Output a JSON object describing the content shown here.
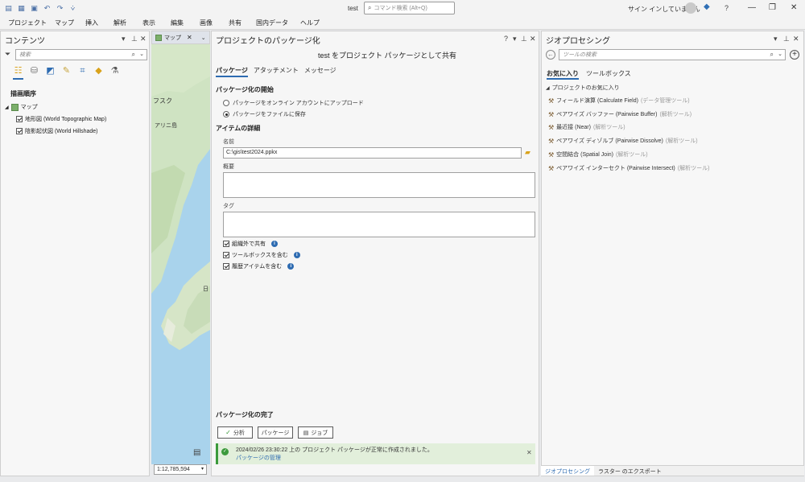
{
  "window": {
    "doc_title": "test",
    "command_search_placeholder": "コマンド検索 (Alt+Q)",
    "signin_text": "サイン インしていません",
    "help": "?"
  },
  "menu": [
    "プロジェクト",
    "マップ",
    "挿入",
    "解析",
    "表示",
    "編集",
    "画像",
    "共有",
    "国内データ",
    "ヘルプ"
  ],
  "contents": {
    "title": "コンテンツ",
    "search_placeholder": "検索",
    "drawing_order_label": "描画順序",
    "map_node": "マップ",
    "layers": [
      "地形図 (World Topographic Map)",
      "陰影起伏図 (World Hillshade)"
    ]
  },
  "map_view": {
    "tab_label": "マップ",
    "labels": [
      "フスク",
      "アリニ島",
      "日"
    ],
    "scale": "1:12,785,594"
  },
  "package": {
    "pane_title": "プロジェクトのパッケージ化",
    "subtitle": "test をプロジェクト パッケージとして共有",
    "tabs": [
      "パッケージ",
      "アタッチメント",
      "メッセージ"
    ],
    "start_section": "パッケージ化の開始",
    "upload_option": "パッケージをオンライン アカウントにアップロード",
    "save_option": "パッケージをファイルに保存",
    "details_section": "アイテムの詳細",
    "name_label": "名前",
    "name_value": "C:\\gis\\test2024.ppkx",
    "summary_label": "概要",
    "tags_label": "タグ",
    "share_outside": "組織外で共有",
    "include_toolboxes": "ツールボックスを含む",
    "include_history": "履歴アイテムを含む",
    "finish_section": "パッケージ化の完了",
    "analyze_button": "分析",
    "package_button": "パッケージ",
    "jobs_button": "ジョブ",
    "status_message": "2024/02/26 23:30:22 上の プロジェクト パッケージが正常に作成されました。",
    "status_link": "パッケージの管理"
  },
  "geoprocessing": {
    "title": "ジオプロセシング",
    "search_placeholder": "ツールの検索",
    "tabs": [
      "お気に入り",
      "ツールボックス"
    ],
    "fav_group": "プロジェクトのお気に入り",
    "favorites": [
      {
        "name": "フィールド演算 (Calculate Field)",
        "category": "(データ管理ツール)"
      },
      {
        "name": "ペアワイズ バッファー (Pairwise Buffer)",
        "category": "(解析ツール)"
      },
      {
        "name": "最近接 (Near)",
        "category": "(解析ツール)"
      },
      {
        "name": "ペアワイズ ディゾルブ (Pairwise Dissolve)",
        "category": "(解析ツール)"
      },
      {
        "name": "空間結合 (Spatial Join)",
        "category": "(解析ツール)"
      },
      {
        "name": "ペアワイズ インターセクト (Pairwise Intersect)",
        "category": "(解析ツール)"
      }
    ],
    "bottom_tabs": [
      "ジオプロセシング",
      "ラスター のエクスポート"
    ]
  }
}
